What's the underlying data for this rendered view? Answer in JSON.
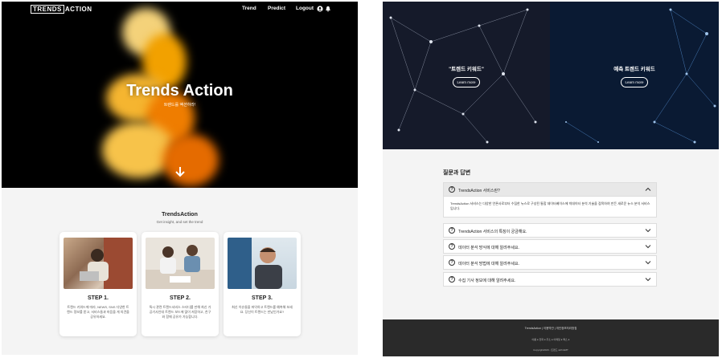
{
  "left": {
    "nav": {
      "logo_box": "TRENDS",
      "logo_rest": "ACTION",
      "links": [
        "Trend",
        "Predict",
        "Logout"
      ]
    },
    "hero": {
      "title": "Trends Action",
      "subtitle": "트렌드를 액션하라!"
    },
    "steps_section": {
      "title": "TrendsAction",
      "subtitle": "Get insight, and set the trend",
      "cards": [
        {
          "step": "STEP 1.",
          "desc": "트렌드 키워드에 따라, NEWS, SNS 다양한 트렌드 정보를 받고, 서비스들과 마음을 게 의견을 공유하세요."
        },
        {
          "step": "STEP 2.",
          "desc": "특시 관련 트렌드서비스 스타디를 만해 최신 가공기사인데 트렌드 보드에 많이 저장하고, 친구와 함께 공유가 가능합니다."
        },
        {
          "step": "STEP 3.",
          "desc": "최신 이슈들을 파악하고 트렌드를 예측해 보세요. 당신이 트렌드는 만났인가요?"
        }
      ]
    }
  },
  "right": {
    "banners": [
      {
        "label": "\"트렌드 키워드\"",
        "button": "Learn more"
      },
      {
        "label": "예측 트렌드 키워드",
        "button": "Learn more"
      }
    ],
    "faq": {
      "title": "질문과 답변",
      "items": [
        {
          "q": "TrendsAction 서비스란?",
          "open": true
        },
        {
          "q": "TrendsAction 서비스의 특징이 궁금해요."
        },
        {
          "q": "데이터 분석 방식에 대해 알려주세요."
        },
        {
          "q": "데이터 분석 방법에 대해 알려주세요."
        },
        {
          "q": "수집 기사 정보에 대해 알려주세요."
        }
      ],
      "answer": "TrendsAction 서비스는 다양한 언론사로부터 수집한 뉴스로 구성된 통합 데이터베이스에 빅데이터 분석 기술을 접목하여 만든 새로운 뉴스 분석 서비스입니다."
    },
    "footer": {
      "top": "TrendsAction | 이용약관 | 개인정보처리방침",
      "mid": "이름 ● 전화 ● 주소 ● 이메일 ● 팩스 ●",
      "copy": "Copyright2020 - 트렌드 with EMT"
    }
  },
  "colors": {
    "hero_bg": "#000000",
    "accent_orange": "#f2a100",
    "footer_bg": "#2a2a2a"
  }
}
